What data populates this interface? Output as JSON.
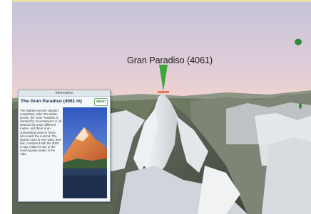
{
  "map": {
    "peak_label": "Gran Paradiso (4061)"
  },
  "info_panel": {
    "header": "Information",
    "title": "The Gran Paradiso (4061 m)",
    "logo_text": "alpen",
    "description": "The highest summit situated completely within the Italian border, the Gran Paradiso is climbed by mountaineers in all seasons by many different routes, and there is an outstanding view for those who reach the summit. The classic route is very easy, and this, combined with the 4000 m tag, makes it one or the most popular peaks in the Alps."
  },
  "colors": {
    "sky_top": "#c7c3d9",
    "sky_horizon": "#ecd2d2",
    "marker": "#3aa53a",
    "marker_base": "#e06a3a",
    "panel_title": "#1b2b4a"
  }
}
